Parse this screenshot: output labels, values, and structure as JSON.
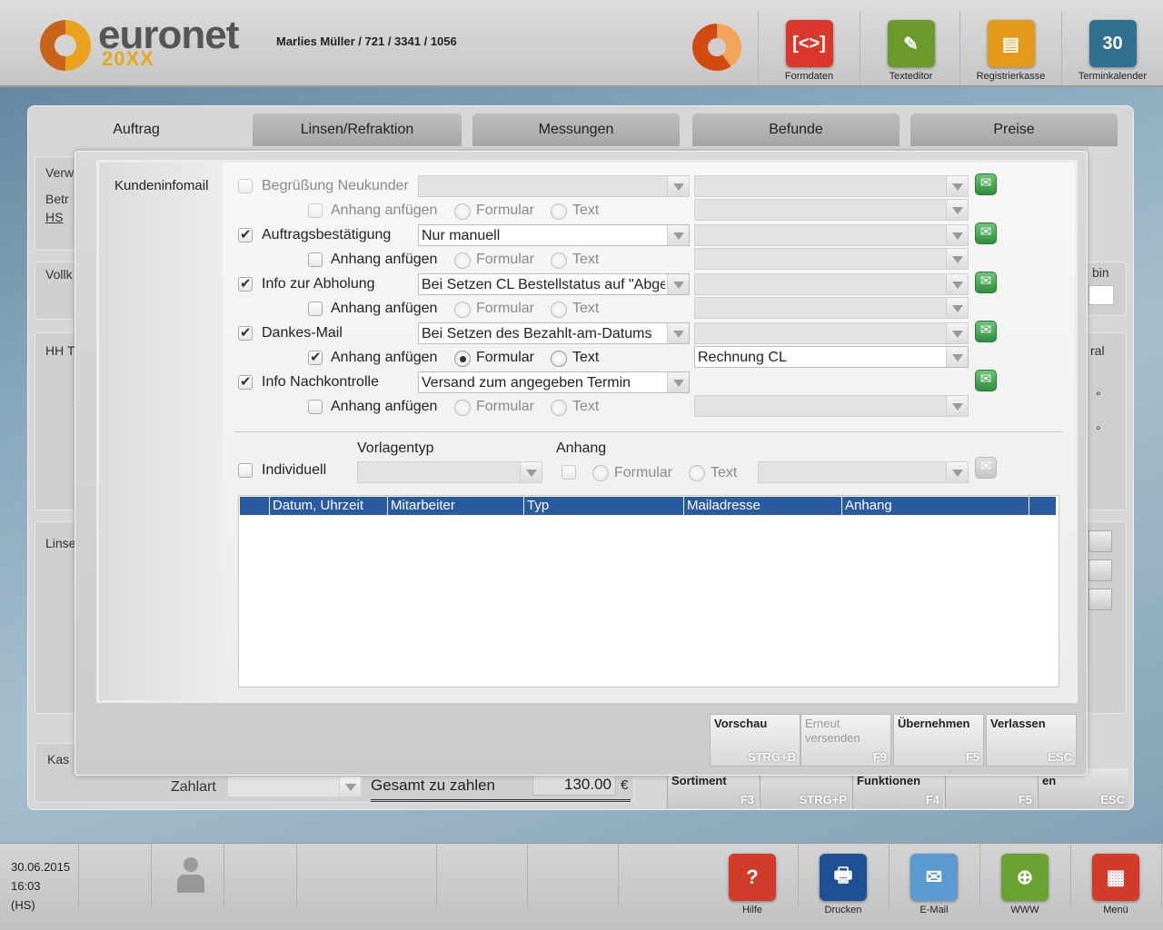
{
  "header": {
    "brand": "euronet",
    "brand_sub": "20XX",
    "user_info": "Marlies Müller / 721 / 3341 / 1056",
    "toolbar": [
      {
        "label": "Formdaten",
        "icon": "form-data-icon",
        "color": "#d9382b",
        "glyph": "[<>]"
      },
      {
        "label": "Texteditor",
        "icon": "pencil-icon",
        "color": "#6a9a2c",
        "glyph": "✎"
      },
      {
        "label": "Registrierkasse",
        "icon": "cash-register-icon",
        "color": "#e39a1a",
        "glyph": "▤"
      },
      {
        "label": "Terminkalender",
        "icon": "calendar-icon",
        "color": "#2f6f8f",
        "glyph": "30"
      }
    ]
  },
  "tabs": [
    "Auftrag",
    "Linsen/Refraktion",
    "Messungen",
    "Befunde",
    "Preise"
  ],
  "background": {
    "verw": "Verw",
    "betr": "Betr",
    "hs": "HS",
    "vollk": "Vollk",
    "hh": "HH T",
    "linse": "Linse",
    "kas": "Kas",
    "bin": "bin",
    "ral": "ral",
    "deg1": "°",
    "deg2": "°",
    "zahlart": "Zahlart",
    "gesamt_label": "Gesamt zu zahlen",
    "gesamt_value": "130.00",
    "currency": "€",
    "back_buttons": [
      {
        "label": "Sortiment",
        "key": "F3"
      },
      {
        "label": "",
        "key": "STRG+P"
      },
      {
        "label": "Funktionen",
        "key": "F4"
      },
      {
        "label": "",
        "key": "F5"
      },
      {
        "label": "en",
        "key": "ESC"
      }
    ]
  },
  "dialog": {
    "sidebar_label": "Kundeninfomail",
    "rows": [
      {
        "label": "Begrüßung Neukunder",
        "checked": false,
        "disabled": true,
        "dropdown": "",
        "dropdown_disabled": true,
        "right": "",
        "attach_checked": false,
        "attach_disabled": true,
        "radio": "",
        "attach_right": "",
        "mail_disabled": false
      },
      {
        "label": "Auftragsbestätigung",
        "checked": true,
        "disabled": false,
        "dropdown": "Nur manuell",
        "dropdown_disabled": false,
        "right": "",
        "attach_checked": false,
        "attach_disabled": false,
        "radio": "",
        "attach_right": "",
        "mail_disabled": false
      },
      {
        "label": "Info zur Abholung",
        "checked": true,
        "disabled": false,
        "dropdown": "Bei Setzen CL Bestellstatus auf \"Abge",
        "dropdown_disabled": false,
        "right": "",
        "attach_checked": false,
        "attach_disabled": false,
        "radio": "",
        "attach_right": "",
        "mail_disabled": false
      },
      {
        "label": "Dankes-Mail",
        "checked": true,
        "disabled": false,
        "dropdown": "Bei Setzen des Bezahlt-am-Datums",
        "dropdown_disabled": false,
        "right": "",
        "attach_checked": true,
        "attach_disabled": false,
        "radio": "formular",
        "attach_right": "Rechnung CL",
        "mail_disabled": false
      },
      {
        "label": "Info Nachkontrolle",
        "checked": true,
        "disabled": false,
        "dropdown": "Versand zum angegeben Termin",
        "dropdown_disabled": false,
        "right": null,
        "attach_checked": false,
        "attach_disabled": false,
        "radio": "",
        "attach_right": "",
        "mail_disabled": false
      }
    ],
    "attach_label": "Anhang anfügen",
    "radio_formular": "Formular",
    "radio_text": "Text",
    "individuell_label": "Individuell",
    "vorlagentyp_label": "Vorlagentyp",
    "anhang_label": "Anhang",
    "table_columns": [
      "Datum, Uhrzeit",
      "Mitarbeiter",
      "Typ",
      "Mailadresse",
      "Anhang"
    ],
    "table_rows": [],
    "buttons": [
      {
        "label": "Vorschau",
        "key": "STRG+B",
        "disabled": false
      },
      {
        "label": "Erneut versenden",
        "key": "F9",
        "disabled": true
      },
      {
        "label": "Übernehmen",
        "key": "F5",
        "disabled": false
      },
      {
        "label": "Verlassen",
        "key": "ESC",
        "disabled": false
      }
    ]
  },
  "footer": {
    "date": "30.06.2015",
    "time": "16:03",
    "user": "(HS)",
    "buttons": [
      {
        "label": "Hilfe",
        "icon": "help-icon",
        "color": "#d23a2a",
        "glyph": "?"
      },
      {
        "label": "Drucken",
        "icon": "printer-icon",
        "color": "#1f4f95",
        "glyph": "🖶"
      },
      {
        "label": "E-Mail",
        "icon": "email-icon",
        "color": "#5a9ad0",
        "glyph": "✉"
      },
      {
        "label": "WWW",
        "icon": "globe-icon",
        "color": "#6aa232",
        "glyph": "⊕"
      },
      {
        "label": "Menü",
        "icon": "menu-grid-icon",
        "color": "#d23a2a",
        "glyph": "▦"
      }
    ]
  }
}
